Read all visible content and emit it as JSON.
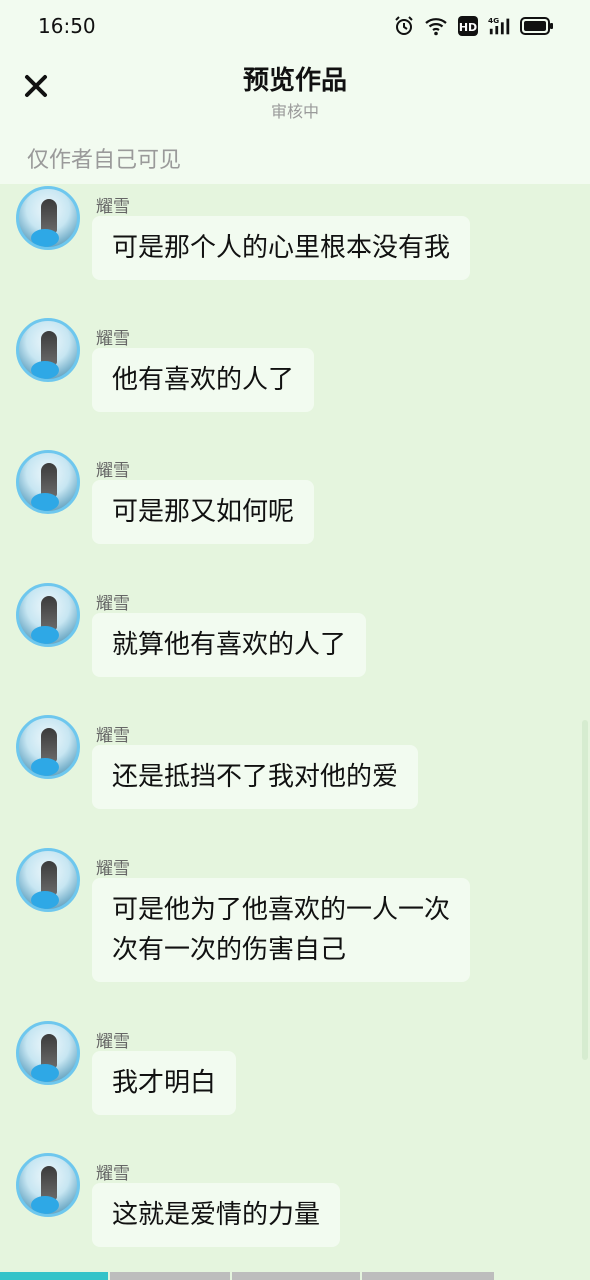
{
  "status_bar": {
    "time": "16:50",
    "icons": [
      "alarm-icon",
      "wifi-icon",
      "hd-icon",
      "signal-4g-icon",
      "battery-icon"
    ]
  },
  "header": {
    "close_icon": "close-icon",
    "title": "预览作品",
    "subtitle": "审核中",
    "visibility_note": "仅作者自己可见"
  },
  "messages": [
    {
      "sender": "耀雪",
      "text": "可是那个人的心里根本没有我"
    },
    {
      "sender": "耀雪",
      "text": "他有喜欢的人了"
    },
    {
      "sender": "耀雪",
      "text": "可是那又如何呢"
    },
    {
      "sender": "耀雪",
      "text": "就算他有喜欢的人了"
    },
    {
      "sender": "耀雪",
      "text": "还是抵挡不了我对他的爱"
    },
    {
      "sender": "耀雪",
      "text": "可是他为了他喜欢的一人一次\n次有一次的伤害自己"
    },
    {
      "sender": "耀雪",
      "text": "我才明白"
    },
    {
      "sender": "耀雪",
      "text": "这就是爱情的力量"
    }
  ],
  "colors": {
    "header_bg": "#f2fbf0",
    "chat_bg": "#e5f5de",
    "bubble_bg": "#f2fbf0",
    "avatar_ring": "#6ec7ee",
    "progress_active": "#34c3c9",
    "progress_inactive": "#bdbdbd"
  },
  "progress": {
    "segments": 4,
    "active_index": 0,
    "active_fill": 1.0
  }
}
